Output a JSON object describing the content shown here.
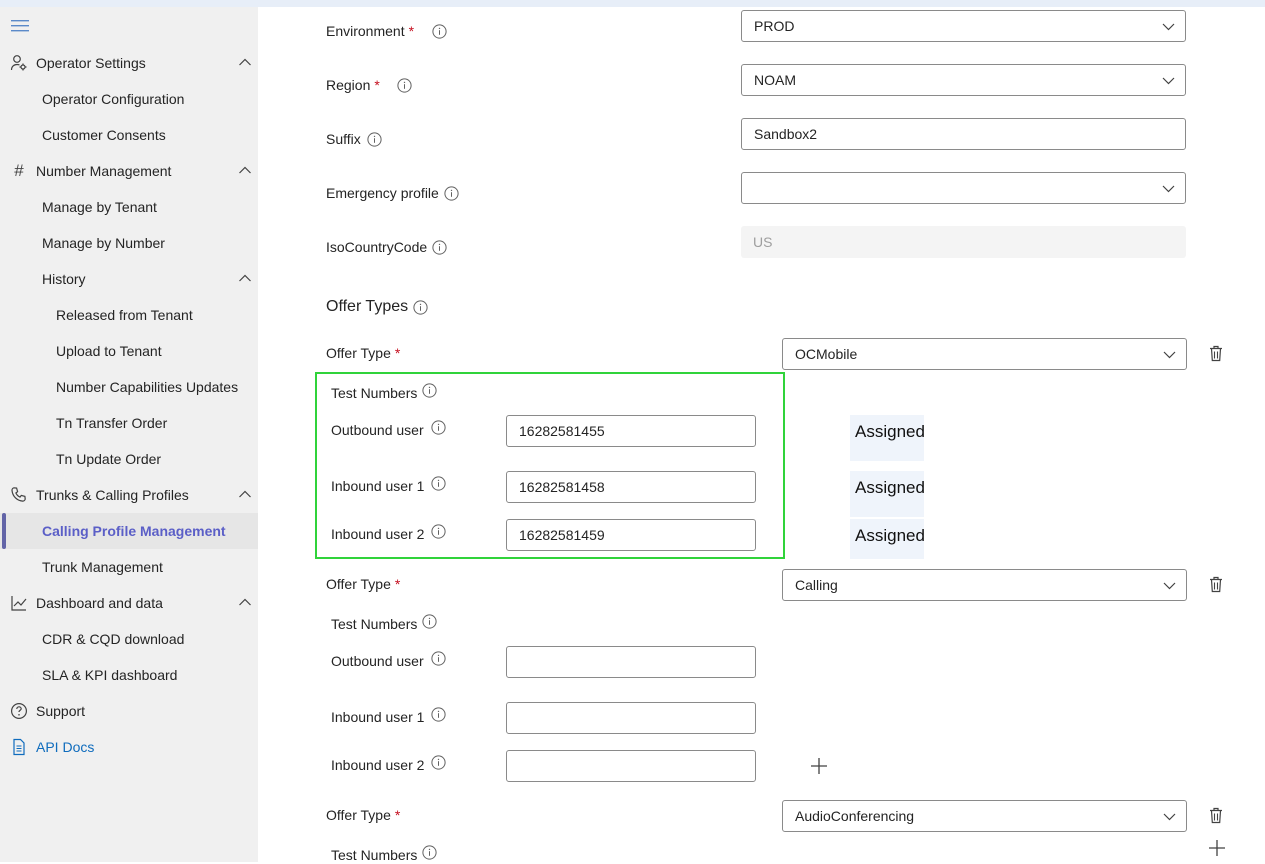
{
  "sidebar": {
    "items": [
      {
        "label": "Operator Settings",
        "icon": "person-settings-icon",
        "expanded": true
      },
      {
        "label": "Operator Configuration"
      },
      {
        "label": "Customer Consents"
      },
      {
        "label": "Number Management",
        "icon": "hash-icon",
        "expanded": true
      },
      {
        "label": "Manage by Tenant"
      },
      {
        "label": "Manage by Number"
      },
      {
        "label": "History",
        "expanded": true
      },
      {
        "label": "Released from Tenant"
      },
      {
        "label": "Upload to Tenant"
      },
      {
        "label": "Number Capabilities Updates"
      },
      {
        "label": "Tn Transfer Order"
      },
      {
        "label": "Tn Update Order"
      },
      {
        "label": "Trunks & Calling Profiles",
        "icon": "phone-icon",
        "expanded": true
      },
      {
        "label": "Calling Profile Management",
        "active": true
      },
      {
        "label": "Trunk Management"
      },
      {
        "label": "Dashboard and data",
        "icon": "chart-line-icon",
        "expanded": true
      },
      {
        "label": "CDR & CQD download"
      },
      {
        "label": "SLA & KPI dashboard"
      },
      {
        "label": "Support",
        "icon": "question-circle-icon"
      },
      {
        "label": "API Docs",
        "icon": "document-icon"
      }
    ]
  },
  "form": {
    "environment": {
      "label": "Environment",
      "value": "PROD"
    },
    "region": {
      "label": "Region",
      "value": "NOAM"
    },
    "suffix": {
      "label": "Suffix",
      "value": "Sandbox2"
    },
    "emergency_profile": {
      "label": "Emergency profile",
      "value": ""
    },
    "iso_country_code": {
      "label": "IsoCountryCode",
      "value": "US"
    },
    "required_mark": "*"
  },
  "offer_types": {
    "title": "Offer Types",
    "offer_type_label": "Offer Type",
    "test_numbers_label": "Test Numbers",
    "outbound_label": "Outbound user",
    "inbound1_label": "Inbound user 1",
    "inbound2_label": "Inbound user 2",
    "offers": [
      {
        "value": "OCMobile",
        "outbound": "16282581455",
        "inbound1": "16282581458",
        "inbound2": "16282581459",
        "status": [
          "Assigned",
          "Assigned",
          "Assigned"
        ]
      },
      {
        "value": "Calling",
        "outbound": "",
        "inbound1": "",
        "inbound2": ""
      },
      {
        "value": "AudioConferencing"
      }
    ]
  },
  "colors": {
    "accent": "#5b5fc7",
    "highlight_border": "#30d33a",
    "link": "#0f6cbd",
    "required": "#c50f1f"
  }
}
